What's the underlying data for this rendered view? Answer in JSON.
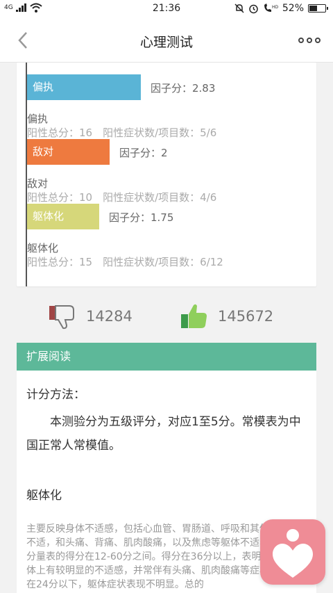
{
  "status_bar": {
    "network": "4G",
    "time": "21:36",
    "battery_percent": "52%",
    "battery_level": 0.52
  },
  "nav": {
    "title": "心理测试"
  },
  "factors": [
    {
      "bar_label": "偏执",
      "score_text": "因子分：2.83",
      "name": "偏执",
      "detail": "阳性总分：16　阳性症状数/项目数：5/6",
      "color": "#5ab4d6",
      "factor_score": 2.83
    },
    {
      "bar_label": "敌对",
      "score_text": "因子分：2",
      "name": "敌对",
      "detail": "阳性总分：10　阳性症状数/项目数：4/6",
      "color": "#ee7a3f",
      "factor_score": 2
    },
    {
      "bar_label": "躯体化",
      "score_text": "因子分：1.75",
      "name": "躯体化",
      "detail": "阳性总分：15　阳性症状数/项目数：6/12",
      "color": "#d6d77a",
      "factor_score": 1.75
    }
  ],
  "votes": {
    "dislike_count": "14284",
    "like_count": "145672"
  },
  "reading": {
    "header": "扩展阅读",
    "scoring_title": "计分方法：",
    "scoring_desc": "本测验分为五级评分，对应1至5分。常模表为中国正常人常模值。",
    "section_title": "躯体化",
    "section_desc": "主要反映身体不适感，包括心血管、胃肠道、呼吸和其他系统的不适，和头痛、背痛、肌肉酸痛，以及焦虑等躯体不适表现。该分量表的得分在12-60分之间。得分在36分以上，表明个体在身体上有较明显的不适感，并常伴有头痛、肌肉酸痛等症状。得分在24分以下，躯体症状表现不明显。总的"
  },
  "colors": {
    "accent_green": "#5db899",
    "fab_pink": "#ef8c96"
  }
}
